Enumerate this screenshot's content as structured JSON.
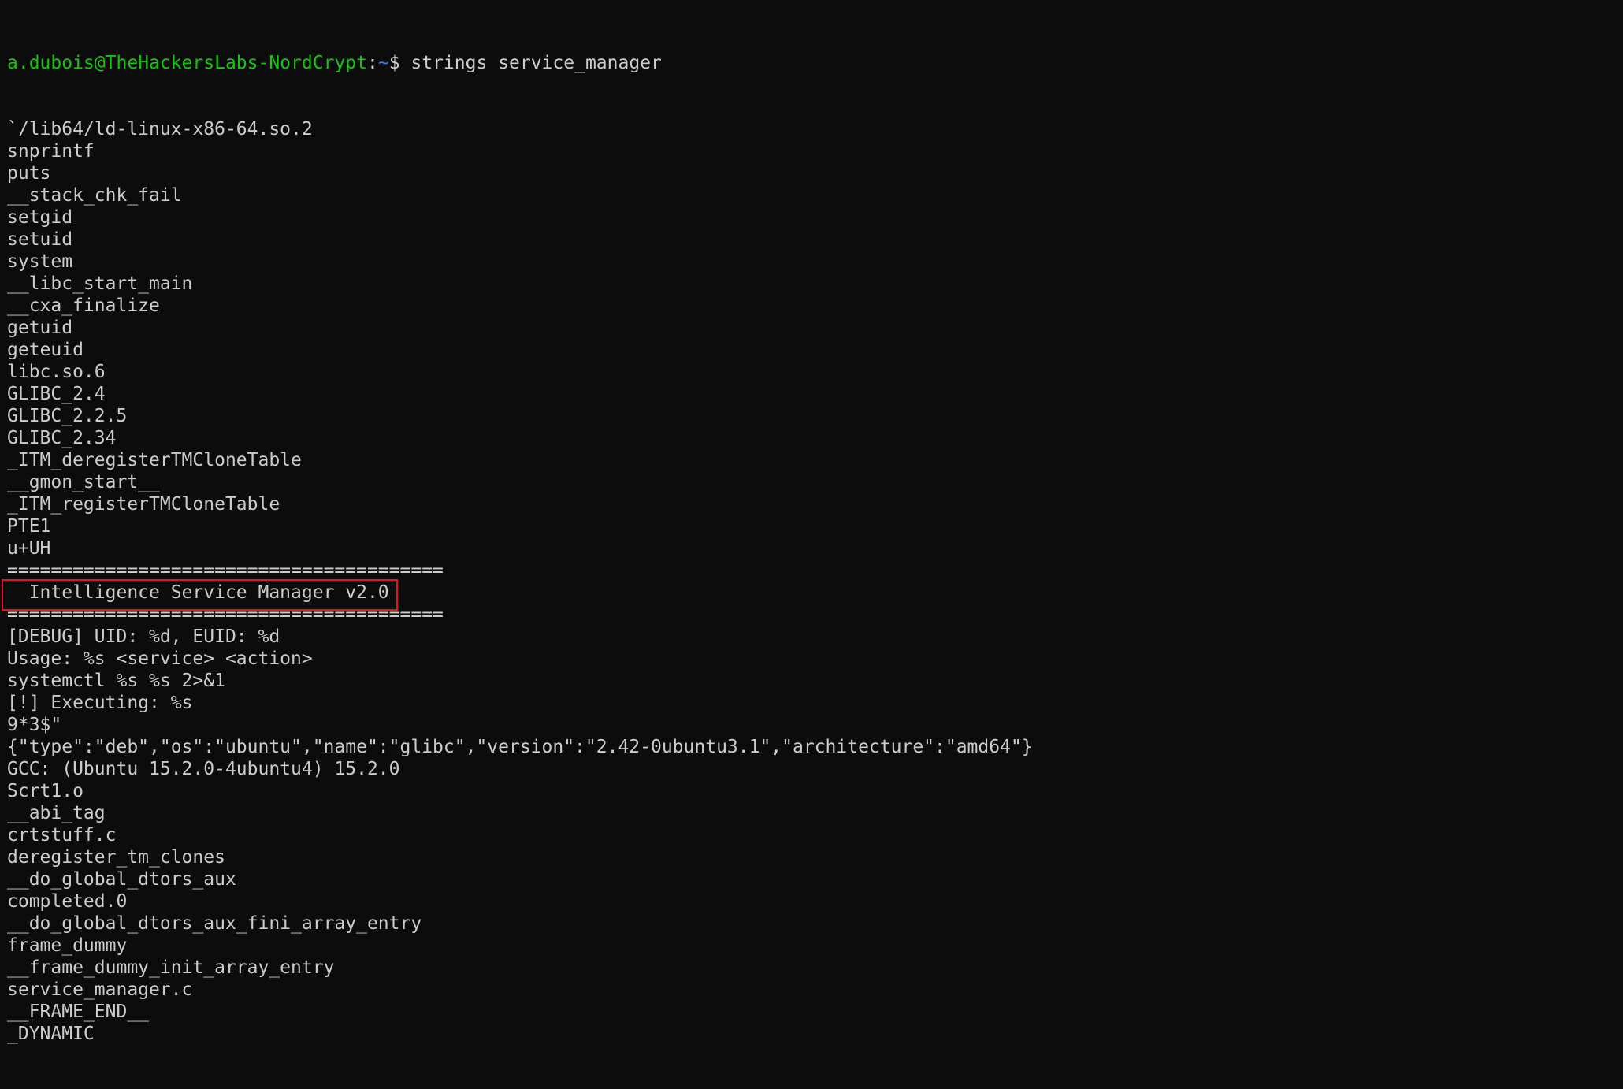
{
  "terminal": {
    "prompt": {
      "user_host": "a.dubois@TheHackersLabs-NordCrypt",
      "separator": ":",
      "path": "~",
      "dollar": "$ ",
      "command": "strings service_manager"
    },
    "colors": {
      "background": "#0c0c0c",
      "foreground": "#cccccc",
      "user_host": "#16c60c",
      "path": "#3b78ff",
      "highlight_border": "#e81123"
    },
    "output_lines": [
      "`/lib64/ld-linux-x86-64.so.2",
      "snprintf",
      "puts",
      "__stack_chk_fail",
      "setgid",
      "setuid",
      "system",
      "__libc_start_main",
      "__cxa_finalize",
      "getuid",
      "geteuid",
      "libc.so.6",
      "GLIBC_2.4",
      "GLIBC_2.2.5",
      "GLIBC_2.34",
      "_ITM_deregisterTMCloneTable",
      "__gmon_start__",
      "_ITM_registerTMCloneTable",
      "PTE1",
      "u+UH",
      "========================================",
      "  Intelligence Service Manager v2.0",
      "========================================",
      "[DEBUG] UID: %d, EUID: %d",
      "Usage: %s <service> <action>",
      "systemctl %s %s 2>&1",
      "[!] Executing: %s",
      "9*3$\"",
      "{\"type\":\"deb\",\"os\":\"ubuntu\",\"name\":\"glibc\",\"version\":\"2.42-0ubuntu3.1\",\"architecture\":\"amd64\"}",
      "GCC: (Ubuntu 15.2.0-4ubuntu4) 15.2.0",
      "Scrt1.o",
      "__abi_tag",
      "crtstuff.c",
      "deregister_tm_clones",
      "__do_global_dtors_aux",
      "completed.0",
      "__do_global_dtors_aux_fini_array_entry",
      "frame_dummy",
      "__frame_dummy_init_array_entry",
      "service_manager.c",
      "__FRAME_END__",
      "_DYNAMIC"
    ]
  }
}
